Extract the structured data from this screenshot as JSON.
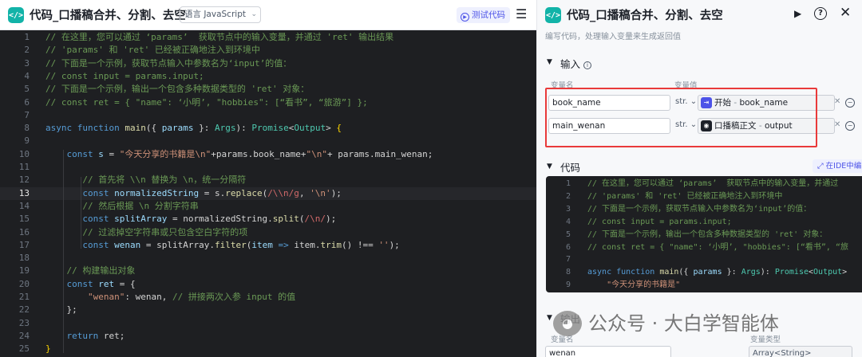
{
  "left_header": {
    "title": "代码_口播稿合并、分割、去空",
    "icon_glyph": "</>",
    "language_label": "语言 JavaScript",
    "test_button_label": "测试代码",
    "test_button_glyph": "▶",
    "collapse_glyph": "☰"
  },
  "editor": {
    "active_line": 13,
    "lines": [
      {
        "n": "1",
        "t": [
          [
            "cm",
            "// 在这里，您可以通过 ‘params’  获取节点中的输入变量，并通过 'ret' 输出结果"
          ]
        ]
      },
      {
        "n": "2",
        "t": [
          [
            "cm",
            "// 'params' 和 'ret' 已经被正确地注入到环境中"
          ]
        ]
      },
      {
        "n": "3",
        "t": [
          [
            "cm",
            "// 下面是一个示例，获取节点输入中参数名为‘input’的值："
          ]
        ]
      },
      {
        "n": "4",
        "t": [
          [
            "cm",
            "// const input = params.input;"
          ]
        ]
      },
      {
        "n": "5",
        "t": [
          [
            "cm",
            "// 下面是一个示例，输出一个包含多种数据类型的 'ret' 对象："
          ]
        ]
      },
      {
        "n": "6",
        "t": [
          [
            "cm",
            "// const ret = { \"name\": ‘小明’, \"hobbies\": [“看书”, “旅游”] };"
          ]
        ]
      },
      {
        "n": "7",
        "t": []
      },
      {
        "n": "8",
        "t": [
          [
            "kw",
            "async function "
          ],
          [
            "fn",
            "main"
          ],
          [
            "",
            "({ "
          ],
          [
            "var",
            "params"
          ],
          [
            "",
            " }: "
          ],
          [
            "ty",
            "Args"
          ],
          [
            "",
            "): "
          ],
          [
            "ty",
            "Promise"
          ],
          [
            "",
            "<"
          ],
          [
            "ty",
            "Output"
          ],
          [
            "",
            "> "
          ],
          [
            "br",
            "{"
          ]
        ]
      },
      {
        "n": "9",
        "t": []
      },
      {
        "n": "10",
        "t": [
          [
            "",
            "    "
          ],
          [
            "kw",
            "const "
          ],
          [
            "var",
            "s"
          ],
          [
            "",
            " = "
          ],
          [
            "str",
            "\"今天分享的书籍是\\n\""
          ],
          [
            "",
            "+params.book_name+"
          ],
          [
            "str",
            "\"\\n\""
          ],
          [
            "",
            "+ params.main_wenan;"
          ]
        ]
      },
      {
        "n": "11",
        "t": []
      },
      {
        "n": "12",
        "t": [
          [
            "",
            "       "
          ],
          [
            "cm",
            "// 首先将 \\\\n 替换为 \\n，统一分隔符"
          ]
        ]
      },
      {
        "n": "13",
        "t": [
          [
            "",
            "       "
          ],
          [
            "kw",
            "const "
          ],
          [
            "var",
            "normalizedString"
          ],
          [
            "",
            " = s."
          ],
          [
            "fn",
            "replace"
          ],
          [
            "",
            "("
          ],
          [
            "rx",
            "/\\\\n/g"
          ],
          [
            "",
            ", "
          ],
          [
            "str",
            "'\\n'"
          ],
          [
            "",
            ");"
          ]
        ]
      },
      {
        "n": "14",
        "t": [
          [
            "",
            "       "
          ],
          [
            "cm",
            "// 然后根据 \\n 分割字符串"
          ]
        ]
      },
      {
        "n": "15",
        "t": [
          [
            "",
            "       "
          ],
          [
            "kw",
            "const "
          ],
          [
            "var",
            "splitArray"
          ],
          [
            "",
            " = normalizedString."
          ],
          [
            "fn",
            "split"
          ],
          [
            "",
            "("
          ],
          [
            "rx",
            "/\\n/"
          ],
          [
            "",
            ");"
          ]
        ]
      },
      {
        "n": "16",
        "t": [
          [
            "",
            "       "
          ],
          [
            "cm",
            "// 过滤掉空字符串或只包含空白字符的项"
          ]
        ]
      },
      {
        "n": "17",
        "t": [
          [
            "",
            "       "
          ],
          [
            "kw",
            "const "
          ],
          [
            "var",
            "wenan"
          ],
          [
            "",
            " = splitArray."
          ],
          [
            "fn",
            "filter"
          ],
          [
            "",
            "("
          ],
          [
            "var",
            "item"
          ],
          [
            "",
            " "
          ],
          [
            "kw",
            "=>"
          ],
          [
            "",
            " item."
          ],
          [
            "fn",
            "trim"
          ],
          [
            "",
            "() !== "
          ],
          [
            "str",
            "''"
          ],
          [
            "",
            ");"
          ]
        ]
      },
      {
        "n": "18",
        "t": []
      },
      {
        "n": "19",
        "t": [
          [
            "",
            "    "
          ],
          [
            "cm",
            "// 构建输出对象"
          ]
        ]
      },
      {
        "n": "20",
        "t": [
          [
            "",
            "    "
          ],
          [
            "kw",
            "const "
          ],
          [
            "var",
            "ret"
          ],
          [
            "",
            " = {"
          ]
        ]
      },
      {
        "n": "21",
        "t": [
          [
            "",
            "        "
          ],
          [
            "str",
            "\"wenan\""
          ],
          [
            "",
            ": wenan, "
          ],
          [
            "cm",
            "// 拼接两次入参 input 的值"
          ]
        ]
      },
      {
        "n": "22",
        "t": [
          [
            "",
            "    };"
          ]
        ]
      },
      {
        "n": "23",
        "t": []
      },
      {
        "n": "24",
        "t": [
          [
            "",
            "    "
          ],
          [
            "kw",
            "return "
          ],
          [
            "",
            "ret;"
          ]
        ]
      },
      {
        "n": "25",
        "t": [
          [
            "br",
            "}"
          ]
        ]
      }
    ]
  },
  "right_panel": {
    "title": "代码_口播稿合并、分割、去空",
    "icon_glyph": "</>",
    "subtitle": "编写代码，处理输入变量来生成返回值",
    "run_glyph": "▶",
    "help_glyph": "?",
    "close_glyph": "✕",
    "input_section": {
      "title": "输入",
      "col_name": "变量名",
      "col_value": "变量值",
      "rows": [
        {
          "name": "book_name",
          "type": "str.",
          "badge_glyph": "⇥",
          "badge_color": "#4d53e8",
          "ref_source": "开始",
          "ref_field": "book_name"
        },
        {
          "name": "main_wenan",
          "type": "str.",
          "badge_glyph": "◉",
          "badge_color": "#1d2129",
          "ref_source": "口播稿正文",
          "ref_field": "output"
        }
      ]
    },
    "code_section": {
      "title": "代码",
      "ide_button_label": "在IDE中编",
      "ide_glyph": "⤢",
      "lines": [
        {
          "n": "1",
          "t": [
            [
              "cm",
              "// 在这里，您可以通过 ‘params’  获取节点中的输入变量，并通过"
            ]
          ]
        },
        {
          "n": "2",
          "t": [
            [
              "cm",
              "// 'params' 和 'ret' 已经被正确地注入到环境中"
            ]
          ]
        },
        {
          "n": "3",
          "t": [
            [
              "cm",
              "// 下面是一个示例，获取节点输入中参数名为‘input’的值："
            ]
          ]
        },
        {
          "n": "4",
          "t": [
            [
              "cm",
              "// const input = params.input;"
            ]
          ]
        },
        {
          "n": "5",
          "t": [
            [
              "cm",
              "// 下面是一个示例，输出一个包含多种数据类型的 'ret' 对象："
            ]
          ]
        },
        {
          "n": "6",
          "t": [
            [
              "cm",
              "// const ret = { \"name\": ‘小明’, \"hobbies\": [“看书”, “旅"
            ]
          ]
        },
        {
          "n": "7",
          "t": []
        },
        {
          "n": "8",
          "t": [
            [
              "kw",
              "async function "
            ],
            [
              "fn",
              "main"
            ],
            [
              "",
              "({ "
            ],
            [
              "var",
              "params"
            ],
            [
              "",
              " }: "
            ],
            [
              "ty",
              "Args"
            ],
            [
              "",
              "): "
            ],
            [
              "ty",
              "Promise"
            ],
            [
              "",
              "<"
            ],
            [
              "ty",
              "Output"
            ],
            [
              "",
              ">"
            ]
          ]
        },
        {
          "n": "9",
          "t": [
            [
              "",
              "    "
            ],
            [
              "str",
              "\"今天分享的书籍是\""
            ]
          ]
        }
      ]
    },
    "output_section": {
      "title": "输出",
      "col_name": "变量名",
      "col_type": "变量类型",
      "name_value": "wenan",
      "type_value": "Array<String>"
    }
  },
  "watermark": {
    "logo_glyph": "◕",
    "text": "公众号 · 大白学智能体"
  }
}
